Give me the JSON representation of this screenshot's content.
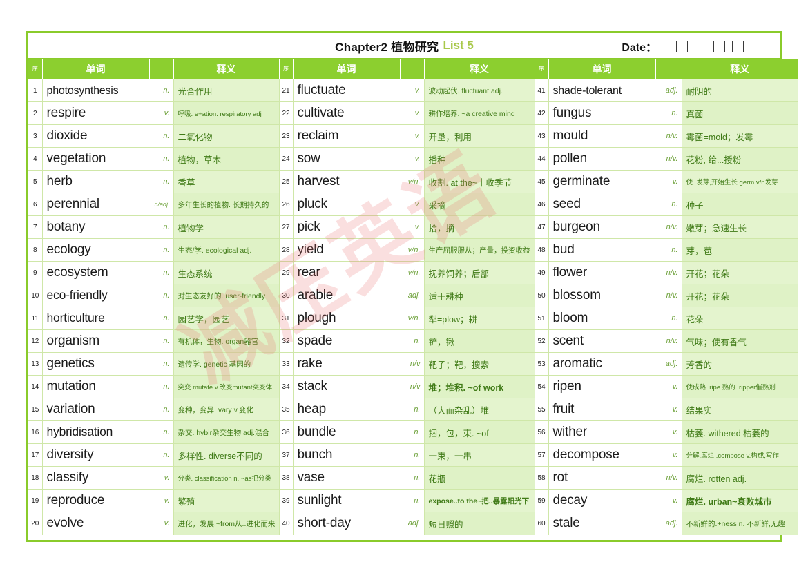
{
  "header": {
    "title_main": "Chapter2 植物研究",
    "title_list": "List 5",
    "date_label": "Date：",
    "date_boxes": 5
  },
  "watermark": {
    "text": "减压英语"
  },
  "columns": {
    "idx_header": "序",
    "word_header": "单词",
    "def_header": "释义"
  },
  "colors": {
    "header_green": "#8CCF2F",
    "border_green": "#8ACB2B",
    "def_bg": "#E4F4CE",
    "def_text": "#3F7A16",
    "pos_text": "#6FA23C",
    "list_label": "#A8C84A"
  },
  "rows": [
    {
      "n1": "1",
      "w1": "photosynthesis",
      "p1": "n.",
      "d1": "光合作用",
      "n2": "21",
      "w2": "fluctuate",
      "p2": "v.",
      "d2": "波动起伏. fluctuant adj.",
      "n3": "41",
      "w3": "shade-tolerant",
      "p3": "adj.",
      "d3": "耐阴的"
    },
    {
      "n1": "2",
      "w1": "respire",
      "p1": "v.",
      "d1": "呼吸. e+ation. respiratory adj",
      "n2": "22",
      "w2": "cultivate",
      "p2": "v.",
      "d2": "耕作培养. ~a creative mind",
      "n3": "42",
      "w3": "fungus",
      "p3": "n.",
      "d3": "真菌"
    },
    {
      "n1": "3",
      "w1": "dioxide",
      "p1": "n.",
      "d1": "二氧化物",
      "n2": "23",
      "w2": "reclaim",
      "p2": "v.",
      "d2": "开垦，利用",
      "n3": "43",
      "w3": "mould",
      "p3": "n/v.",
      "d3": "霉菌=mold；发霉"
    },
    {
      "n1": "4",
      "w1": "vegetation",
      "p1": "n.",
      "d1": "植物，草木",
      "n2": "24",
      "w2": "sow",
      "p2": "v.",
      "d2": "播种",
      "n3": "44",
      "w3": "pollen",
      "p3": "n/v.",
      "d3": "花粉, 给...授粉"
    },
    {
      "n1": "5",
      "w1": "herb",
      "p1": "n.",
      "d1": "香草",
      "n2": "25",
      "w2": "harvest",
      "p2": "v/n.",
      "d2": "收割. at the~丰收季节",
      "n3": "45",
      "w3": "germinate",
      "p3": "v.",
      "d3": "使..发芽,开始生长.germ v/n发芽"
    },
    {
      "n1": "6",
      "w1": "perennial",
      "p1": "n/adj.",
      "d1": "多年生长的植物. 长期持久的",
      "n2": "26",
      "w2": "pluck",
      "p2": "v.",
      "d2": "采摘",
      "n3": "46",
      "w3": "seed",
      "p3": "n.",
      "d3": "种子"
    },
    {
      "n1": "7",
      "w1": "botany",
      "p1": "n.",
      "d1": "植物学",
      "n2": "27",
      "w2": "pick",
      "p2": "v.",
      "d2": "拾，摘",
      "n3": "47",
      "w3": "burgeon",
      "p3": "n/v.",
      "d3": "嫩芽；急速生长"
    },
    {
      "n1": "8",
      "w1": "ecology",
      "p1": "n.",
      "d1": "生态/学. ecological adj.",
      "n2": "28",
      "w2": "yield",
      "p2": "v/n.",
      "d2": "生产屈服服从；产量，投资收益",
      "n3": "48",
      "w3": "bud",
      "p3": "n.",
      "d3": "芽，苞"
    },
    {
      "n1": "9",
      "w1": "ecosystem",
      "p1": "n.",
      "d1": "生态系统",
      "n2": "29",
      "w2": "rear",
      "p2": "v/n.",
      "d2": "抚养饲养；后部",
      "n3": "49",
      "w3": "flower",
      "p3": "n/v.",
      "d3": "开花；花朵"
    },
    {
      "n1": "10",
      "w1": "eco-friendly",
      "p1": "n.",
      "d1": "对生态友好的. user-friendly",
      "n2": "30",
      "w2": "arable",
      "p2": "adj.",
      "d2": "适于耕种",
      "n3": "50",
      "w3": "blossom",
      "p3": "n/v.",
      "d3": "开花；花朵"
    },
    {
      "n1": "11",
      "w1": "horticulture",
      "p1": "n.",
      "d1": "园艺学，园艺",
      "n2": "31",
      "w2": "plough",
      "p2": "v/n.",
      "d2": "犁=plow；耕",
      "n3": "51",
      "w3": "bloom",
      "p3": "n.",
      "d3": "花朵"
    },
    {
      "n1": "12",
      "w1": "organism",
      "p1": "n.",
      "d1": "有机体，生物. organ器官",
      "n2": "32",
      "w2": "spade",
      "p2": "n.",
      "d2": "铲，锹",
      "n3": "52",
      "w3": "scent",
      "p3": "n/v.",
      "d3": "气味；使有香气"
    },
    {
      "n1": "13",
      "w1": "genetics",
      "p1": "n.",
      "d1": "遗传学. genetic 基因的",
      "n2": "33",
      "w2": "rake",
      "p2": "n/v",
      "d2": "靶子；靶，搜索",
      "n3": "53",
      "w3": "aromatic",
      "p3": "adj.",
      "d3": "芳香的"
    },
    {
      "n1": "14",
      "w1": "mutation",
      "p1": "n.",
      "d1": "突变.mutate v.改变mutant突变体",
      "n2": "34",
      "w2": "stack",
      "p2": "n/v",
      "d2": "堆；堆积. ~of work",
      "n3": "54",
      "w3": "ripen",
      "p3": "v.",
      "d3": "使成熟. ripe 熟的. ripper催熟剂"
    },
    {
      "n1": "15",
      "w1": "variation",
      "p1": "n.",
      "d1": "变种，变异. vary v.变化",
      "n2": "35",
      "w2": "heap",
      "p2": "n.",
      "d2": "（大而杂乱）堆",
      "n3": "55",
      "w3": "fruit",
      "p3": "v.",
      "d3": "结果实"
    },
    {
      "n1": "16",
      "w1": "hybridisation",
      "p1": "n.",
      "d1": "杂交. hybir杂交生物 adj.混合",
      "n2": "36",
      "w2": "bundle",
      "p2": "n.",
      "d2": "捆，包，束. ~of",
      "n3": "56",
      "w3": "wither",
      "p3": "v.",
      "d3": "枯萎. withered 枯萎的"
    },
    {
      "n1": "17",
      "w1": "diversity",
      "p1": "n.",
      "d1": "多样性. diverse不同的",
      "n2": "37",
      "w2": "bunch",
      "p2": "n.",
      "d2": "一束，一串",
      "n3": "57",
      "w3": "decompose",
      "p3": "v.",
      "d3": "分解,腐烂..compose v.构成,写作"
    },
    {
      "n1": "18",
      "w1": "classify",
      "p1": "v.",
      "d1": "分类. classification n. ~as把分类",
      "n2": "38",
      "w2": "vase",
      "p2": "n.",
      "d2": "花瓶",
      "n3": "58",
      "w3": "rot",
      "p3": "n/v.",
      "d3": "腐烂. rotten adj."
    },
    {
      "n1": "19",
      "w1": "reproduce",
      "p1": "v.",
      "d1": "繁殖",
      "n2": "39",
      "w2": "sunlight",
      "p2": "n.",
      "d2": "expose..to the~把..暴露阳光下",
      "n3": "59",
      "w3": "decay",
      "p3": "v.",
      "d3": "腐烂. urban~衰败城市"
    },
    {
      "n1": "20",
      "w1": "evolve",
      "p1": "v.",
      "d1": "进化，发展.~from从..进化而来",
      "n2": "40",
      "w2": "short-day",
      "p2": "adj.",
      "d2": "短日照的",
      "n3": "60",
      "w3": "stale",
      "p3": "adj.",
      "d3": "不新鲜的.+ness n. 不新鲜,无趣"
    }
  ]
}
